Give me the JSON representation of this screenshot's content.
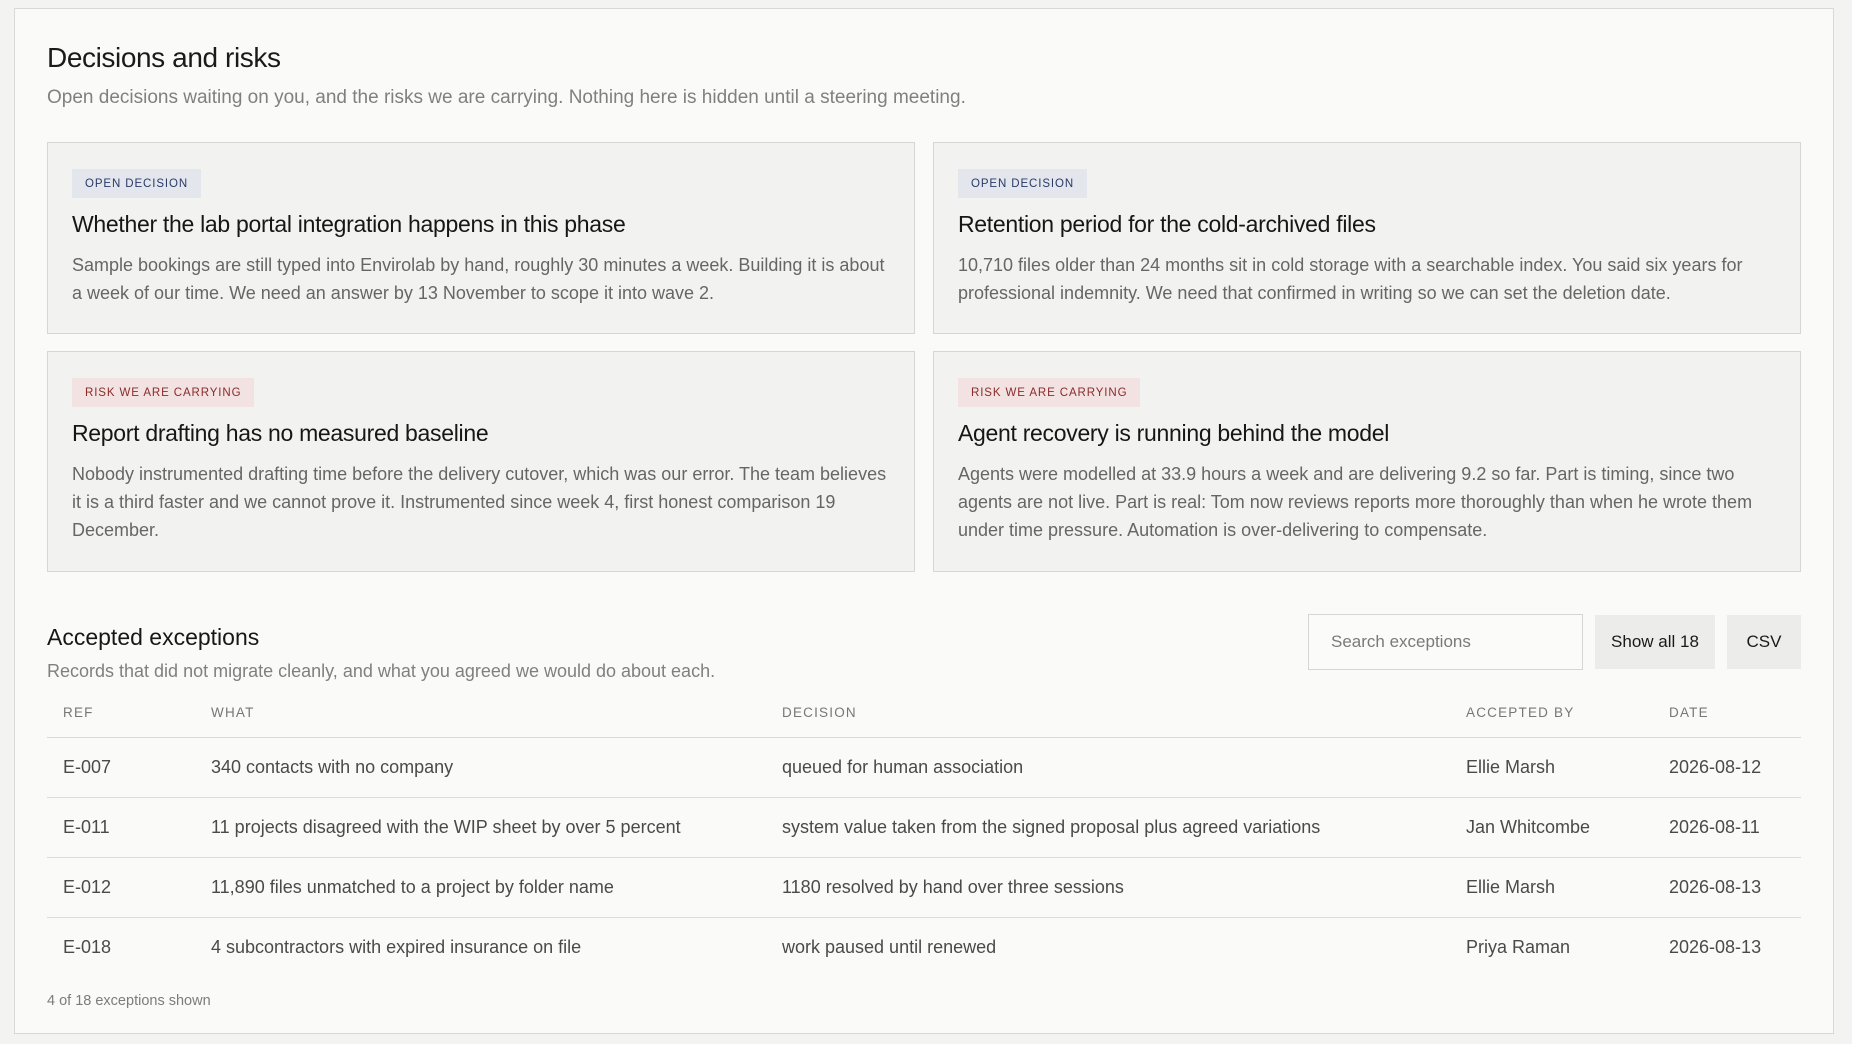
{
  "header": {
    "title": "Decisions and risks",
    "subtitle": "Open decisions waiting on you, and the risks we are carrying. Nothing here is hidden until a steering meeting."
  },
  "cards": [
    {
      "tag": "Open decision",
      "kind": "decision",
      "title": "Whether the lab portal integration happens in this phase",
      "body": "Sample bookings are still typed into Envirolab by hand, roughly 30 minutes a week. Building it is about a week of our time. We need an answer by 13 November to scope it into wave 2."
    },
    {
      "tag": "Open decision",
      "kind": "decision",
      "title": "Retention period for the cold-archived files",
      "body": "10,710 files older than 24 months sit in cold storage with a searchable index. You said six years for professional indemnity. We need that confirmed in writing so we can set the deletion date."
    },
    {
      "tag": "Risk we are carrying",
      "kind": "risk",
      "title": "Report drafting has no measured baseline",
      "body": "Nobody instrumented drafting time before the delivery cutover, which was our error. The team believes it is a third faster and we cannot prove it. Instrumented since week 4, first honest comparison 19 December."
    },
    {
      "tag": "Risk we are carrying",
      "kind": "risk",
      "title": "Agent recovery is running behind the model",
      "body": "Agents were modelled at 33.9 hours a week and are delivering 9.2 so far. Part is timing, since two agents are not live. Part is real: Tom now reviews reports more thoroughly than when he wrote them under time pressure. Automation is over-delivering to compensate."
    }
  ],
  "exceptions": {
    "title": "Accepted exceptions",
    "subtitle": "Records that did not migrate cleanly, and what you agreed we would do about each.",
    "search_placeholder": "Search exceptions",
    "show_all_label": "Show all 18",
    "csv_label": "CSV",
    "columns": {
      "ref": "Ref",
      "what": "What",
      "decision": "Decision",
      "accepted_by": "Accepted by",
      "date": "Date"
    },
    "rows": [
      {
        "ref": "E-007",
        "what": "340 contacts with no company",
        "decision": "queued for human association",
        "accepted_by": "Ellie Marsh",
        "date": "2026-08-12"
      },
      {
        "ref": "E-011",
        "what": "11 projects disagreed with the WIP sheet by over 5 percent",
        "decision": "system value taken from the signed proposal plus agreed variations",
        "accepted_by": "Jan Whitcombe",
        "date": "2026-08-11"
      },
      {
        "ref": "E-012",
        "what": "11,890 files unmatched to a project by folder name",
        "decision": "1180 resolved by hand over three sessions",
        "accepted_by": "Ellie Marsh",
        "date": "2026-08-13"
      },
      {
        "ref": "E-018",
        "what": "4 subcontractors with expired insurance on file",
        "decision": "work paused until renewed",
        "accepted_by": "Priya Raman",
        "date": "2026-08-13"
      }
    ],
    "footnote": "4 of 18 exceptions shown"
  }
}
